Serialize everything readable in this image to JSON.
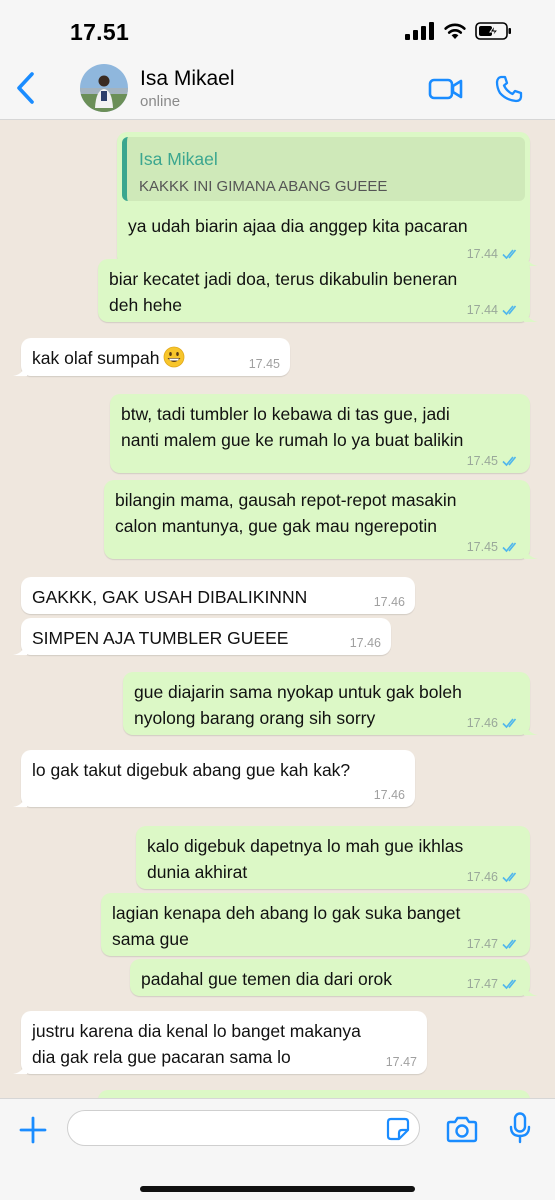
{
  "status_bar": {
    "time": "17.51"
  },
  "header": {
    "contact_name": "Isa Mikael",
    "contact_status": "online"
  },
  "messages": [
    {
      "direction": "out",
      "reply_to": {
        "name": "Isa Mikael",
        "text": "KAKKK INI GIMANA ABANG GUEEE"
      },
      "lines": [
        "ya udah biarin ajaa dia anggep kita pacaran"
      ],
      "time": "17.44",
      "read": true
    },
    {
      "direction": "out",
      "lines": [
        "biar kecatet jadi doa, terus dikabulin beneran",
        "deh hehe"
      ],
      "time": "17.44",
      "read": true
    },
    {
      "direction": "in",
      "lines": [
        "kak olaf sumpah"
      ],
      "emoji": "grinning-face",
      "time": "17.45"
    },
    {
      "direction": "out",
      "lines": [
        "btw, tadi tumbler lo kebawa di tas gue, jadi",
        "nanti malem gue ke rumah lo ya buat balikin"
      ],
      "time": "17.45",
      "read": true
    },
    {
      "direction": "out",
      "lines": [
        "bilangin mama, gausah repot-repot masakin",
        "calon mantunya, gue gak mau ngerepotin"
      ],
      "time": "17.45",
      "read": true
    },
    {
      "direction": "in",
      "lines": [
        "GAKKK, GAK USAH DIBALIKINNN"
      ],
      "time": "17.46"
    },
    {
      "direction": "in",
      "lines": [
        "SIMPEN AJA TUMBLER GUEEE"
      ],
      "time": "17.46"
    },
    {
      "direction": "out",
      "lines": [
        "gue diajarin sama nyokap untuk gak boleh",
        "nyolong barang orang sih sorry"
      ],
      "time": "17.46",
      "read": true
    },
    {
      "direction": "in",
      "lines": [
        "lo gak takut digebuk abang gue kah kak?"
      ],
      "time": "17.46"
    },
    {
      "direction": "out",
      "lines": [
        "kalo digebuk dapetnya lo mah gue ikhlas",
        "dunia akhirat"
      ],
      "time": "17.46",
      "read": true
    },
    {
      "direction": "out",
      "lines": [
        "lagian kenapa deh abang lo gak suka banget",
        "sama gue"
      ],
      "time": "17.47",
      "read": true
    },
    {
      "direction": "out",
      "lines": [
        "padahal gue temen dia dari orok"
      ],
      "time": "17.47",
      "read": true
    },
    {
      "direction": "in",
      "lines": [
        "justru karena dia kenal lo banget makanya",
        "dia gak rela gue pacaran sama lo"
      ],
      "time": "17.47"
    }
  ],
  "input_bar": {
    "placeholder": ""
  },
  "colors": {
    "accent": "#1a8cff",
    "outgoing_bubble": "#dcf8c6",
    "incoming_bubble": "#ffffff",
    "background": "#efe7de",
    "read_tick": "#4fb6ec",
    "reply_name": "#3ba68f"
  }
}
